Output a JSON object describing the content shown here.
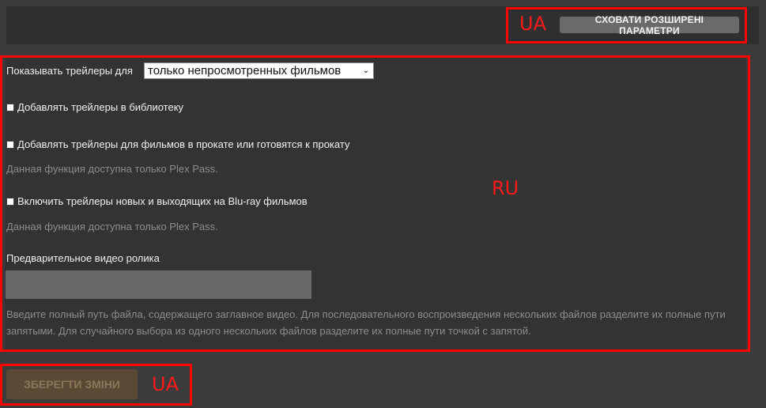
{
  "header": {
    "hide_advanced_button": "СХОВАТИ РОЗШИРЕНІ ПАРАМЕТРИ",
    "lang_label": "UA"
  },
  "settings": {
    "show_trailers_label": "Показывать трейлеры для",
    "show_trailers_selected": "только непросмотренных фильмов",
    "add_to_library_label": "Добавлять трейлеры в библиотеку",
    "add_to_library_checked": false,
    "add_in_theaters_label": "Добавлять трейлеры для фильмов в прокате или готовятся к прокату",
    "add_in_theaters_checked": false,
    "plex_pass_note_1": "Данная функция доступна только Plex Pass.",
    "bluray_label": "Включить трейлеры новых и выходящих на Blu-ray фильмов",
    "bluray_checked": false,
    "plex_pass_note_2": "Данная функция доступна только Plex Pass.",
    "preroll_label": "Предварительное видео ролика",
    "preroll_value": "",
    "preroll_description": "Введите полный путь файла, содержащего заглавное видео. Для последовательного воспроизведения нескольких файлов разделите их полные пути запятыми. Для случайного выбора из одного нескольких файлов разделите их полные пути точкой с запятой.",
    "lang_label": "RU"
  },
  "footer": {
    "save_button": "ЗБЕРЕГТИ ЗМІНИ",
    "lang_label": "UA"
  },
  "colors": {
    "annotation": "#ff0000",
    "background": "#3b3b3b",
    "save_button_bg": "#5a4a35"
  }
}
